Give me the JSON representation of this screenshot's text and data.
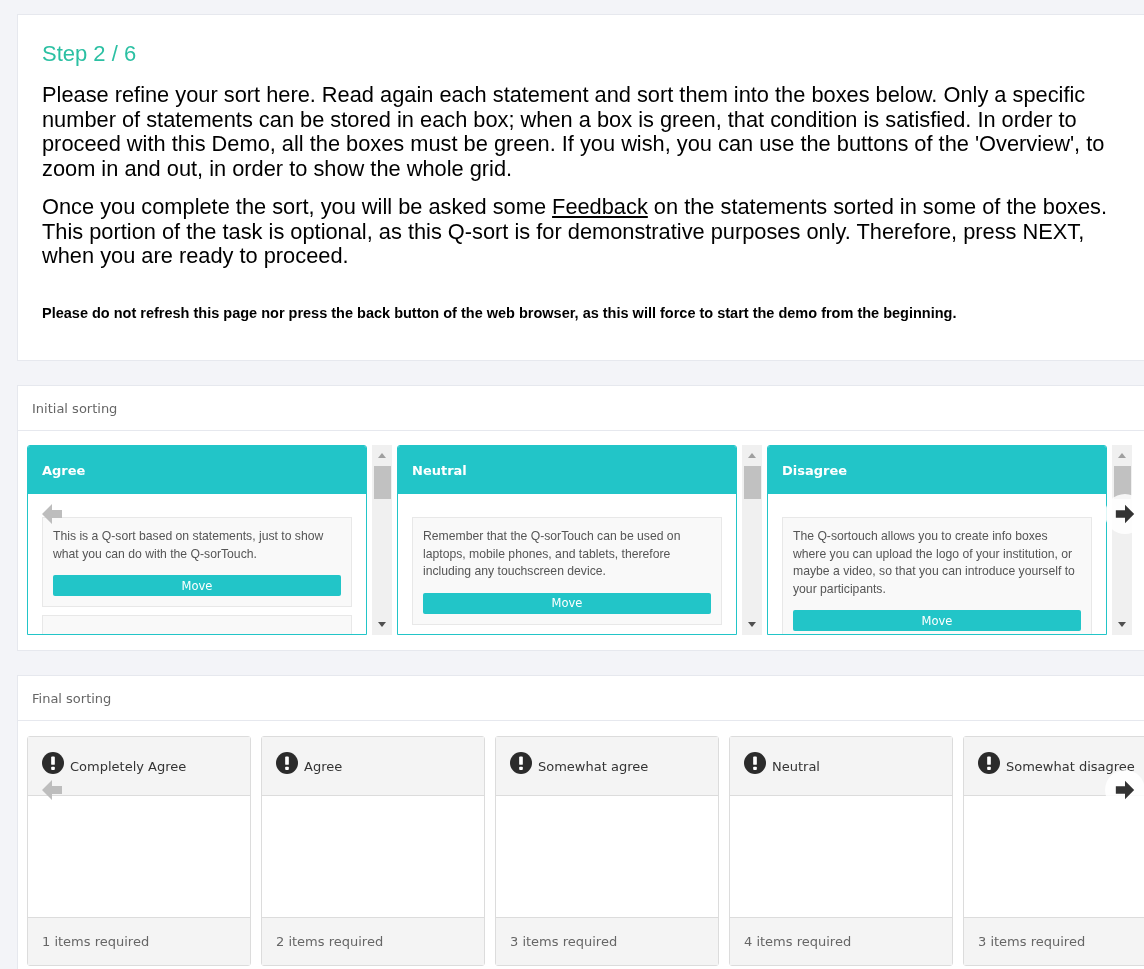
{
  "step": "Step 2 / 6",
  "intro": {
    "paragraphs": [
      [
        {
          "text": "Please refine your sort here. Read again each statement and sort them into the boxes below. Only a specific number of statements can be stored in each box; when a box is green, that condition is satisfied. In order to proceed with this Demo, all the boxes must be green. If you wish, you can use the buttons of the 'Overview', to zoom in and out, in order to show the whole grid.",
          "kind": "text"
        }
      ],
      [
        {
          "text": "Once you complete the sort, you will be asked some",
          "kind": "text"
        },
        {
          "text": "Feedback",
          "kind": "link"
        },
        {
          "text": "on the statements sorted in some of the boxes. This portion of the task is optional, as this Q-sort is for demonstrative purposes only. Therefore, press NEXT, when you are ready to proceed.",
          "kind": "text"
        }
      ]
    ],
    "warning": "Please do not refresh this page nor press the back button of the web browser, as this will force to start the demo from the beginning."
  },
  "initial_sorting": {
    "title": "Initial sorting",
    "columns": [
      {
        "title": "Agree",
        "more_below": true,
        "statements": [
          {
            "text": "This is a Q-sort based on statements, just to show what you can do with the Q-sorTouch.",
            "button": "Move"
          }
        ]
      },
      {
        "title": "Neutral",
        "more_below": false,
        "statements": [
          {
            "text": "Remember that the Q-sorTouch can be used on laptops, mobile phones, and tablets, therefore including any touchscreen device.",
            "button": "Move"
          }
        ]
      },
      {
        "title": "Disagree",
        "more_below": false,
        "statements": [
          {
            "text": "The Q-sortouch allows you to create info boxes where you can upload the logo of your institution, or maybe a video, so that you can introduce yourself to your participants.",
            "button": "Move"
          }
        ]
      }
    ]
  },
  "final_sorting": {
    "title": "Final sorting",
    "boxes": [
      {
        "title": "Completely Agree",
        "satisfied": false,
        "footer": "1 items required"
      },
      {
        "title": "Agree",
        "satisfied": false,
        "footer": "2 items required"
      },
      {
        "title": "Somewhat agree",
        "satisfied": false,
        "footer": "3 items required"
      },
      {
        "title": "Neutral",
        "satisfied": false,
        "footer": "4 items required"
      },
      {
        "title": "Somewhat disagree",
        "satisfied": false,
        "footer": "3 items required"
      }
    ]
  }
}
